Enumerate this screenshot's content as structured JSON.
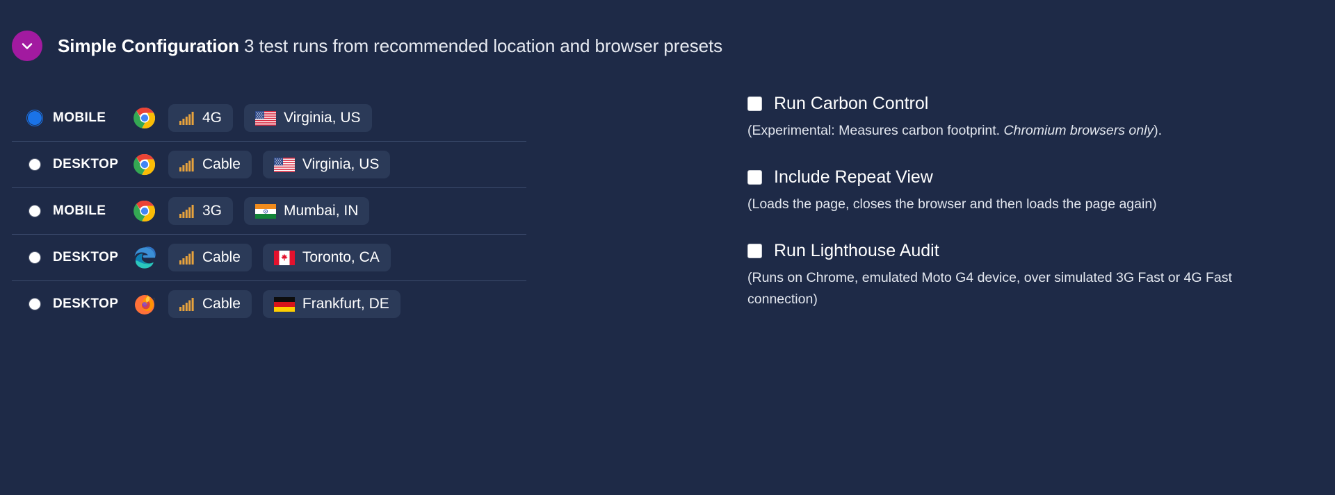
{
  "header": {
    "chevron_icon": "chevron-down-icon",
    "title": "Simple Configuration",
    "subtitle": " 3 test runs from recommended location and browser presets",
    "accent_color": "#a21aa0"
  },
  "theme": {
    "background": "#1e2a47",
    "pill_background": "#2b3a58",
    "divider": "#3c4b6d",
    "radio_selected": "#1a73e8",
    "signal_bar_color": "#e8a33d",
    "text": "#ffffff"
  },
  "presets": [
    {
      "selected": true,
      "device": "MOBILE",
      "browser_icon": "chrome-icon",
      "connection_icon": "signal-bars-icon",
      "connection": "4G",
      "flag_icon": "flag-us-icon",
      "location": "Virginia, US"
    },
    {
      "selected": false,
      "device": "DESKTOP",
      "browser_icon": "chrome-icon",
      "connection_icon": "signal-bars-icon",
      "connection": "Cable",
      "flag_icon": "flag-us-icon",
      "location": "Virginia, US"
    },
    {
      "selected": false,
      "device": "MOBILE",
      "browser_icon": "chrome-icon",
      "connection_icon": "signal-bars-icon",
      "connection": "3G",
      "flag_icon": "flag-in-icon",
      "location": "Mumbai, IN"
    },
    {
      "selected": false,
      "device": "DESKTOP",
      "browser_icon": "edge-icon",
      "connection_icon": "signal-bars-icon",
      "connection": "Cable",
      "flag_icon": "flag-ca-icon",
      "location": "Toronto, CA"
    },
    {
      "selected": false,
      "device": "DESKTOP",
      "browser_icon": "firefox-icon",
      "connection_icon": "signal-bars-icon",
      "connection": "Cable",
      "flag_icon": "flag-de-icon",
      "location": "Frankfurt, DE"
    }
  ],
  "options": [
    {
      "checked": false,
      "title": "Run Carbon Control",
      "desc_pre": "(Experimental: Measures carbon footprint. ",
      "desc_italic": "Chromium browsers only",
      "desc_post": ")."
    },
    {
      "checked": false,
      "title": "Include Repeat View",
      "desc_pre": "(Loads the page, closes the browser and then loads the page again)",
      "desc_italic": "",
      "desc_post": ""
    },
    {
      "checked": false,
      "title": "Run Lighthouse Audit",
      "desc_pre": "(Runs on Chrome, emulated Moto G4 device, over simulated 3G Fast or 4G Fast connection)",
      "desc_italic": "",
      "desc_post": ""
    }
  ]
}
